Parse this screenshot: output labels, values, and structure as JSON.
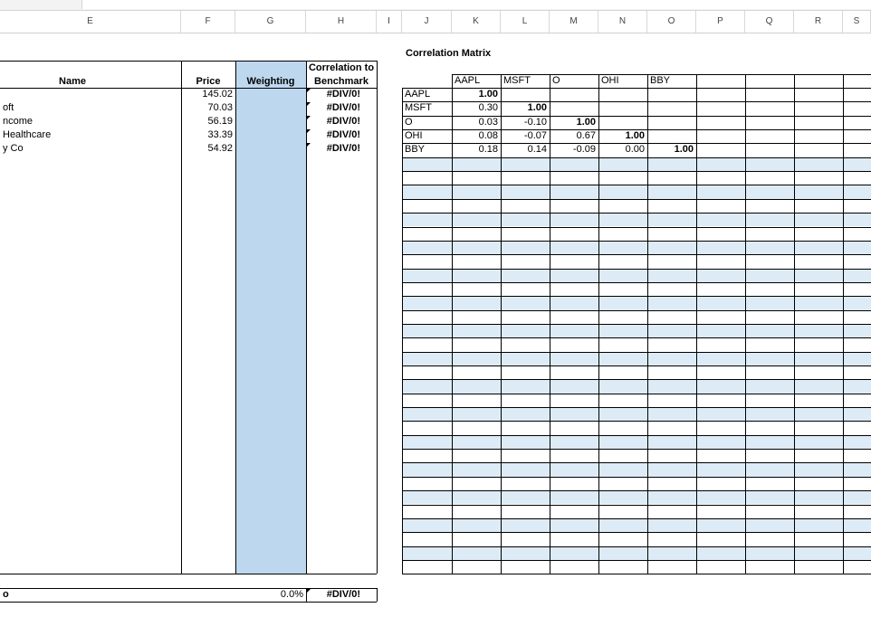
{
  "columns": [
    "E",
    "F",
    "G",
    "H",
    "I",
    "J",
    "K",
    "L",
    "M",
    "N",
    "O",
    "P",
    "Q",
    "R",
    "S"
  ],
  "portfolio": {
    "headers": {
      "name": "Name",
      "price": "Price",
      "weighting": "Weighting",
      "corr_line1": "Correlation to",
      "corr_line2": "Benchmark"
    },
    "rows": [
      {
        "name": "",
        "price": "145.02",
        "corr": "#DIV/0!"
      },
      {
        "name": "oft",
        "price": "70.03",
        "corr": "#DIV/0!"
      },
      {
        "name": "ncome",
        "price": "56.19",
        "corr": "#DIV/0!"
      },
      {
        "name": "Healthcare",
        "price": "33.39",
        "corr": "#DIV/0!"
      },
      {
        "name": "y Co",
        "price": "54.92",
        "corr": "#DIV/0!"
      }
    ],
    "total": {
      "label": "o",
      "weighting": "0.0%",
      "corr": "#DIV/0!"
    }
  },
  "matrix": {
    "title": "Correlation Matrix",
    "col_headers": [
      "AAPL",
      "MSFT",
      "O",
      "OHI",
      "BBY"
    ],
    "row_labels": [
      "AAPL",
      "MSFT",
      "O",
      "OHI",
      "BBY"
    ],
    "values": [
      [
        "1.00",
        "",
        "",
        "",
        ""
      ],
      [
        "0.30",
        "1.00",
        "",
        "",
        ""
      ],
      [
        "0.03",
        "-0.10",
        "1.00",
        "",
        ""
      ],
      [
        "0.08",
        "-0.07",
        "0.67",
        "1.00",
        ""
      ],
      [
        "0.18",
        "0.14",
        "-0.09",
        "0.00",
        "1.00"
      ]
    ]
  },
  "colors": {
    "weighting_fill": "#bdd7ee",
    "band_fill": "#ddebf7"
  }
}
